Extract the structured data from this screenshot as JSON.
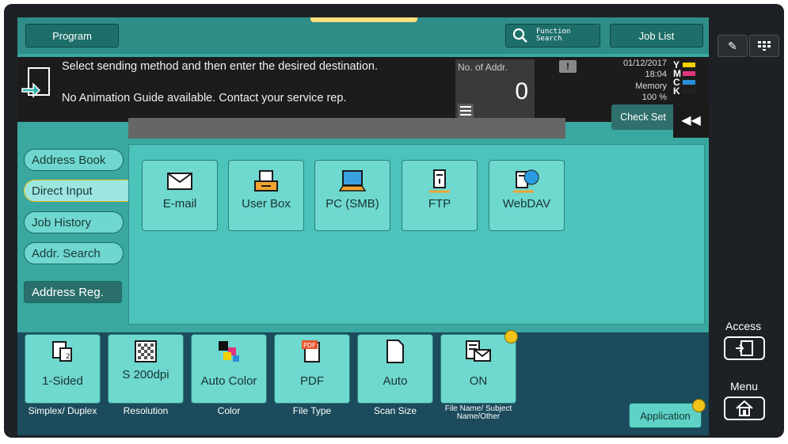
{
  "header": {
    "program_label": "Program",
    "function_search_label": "Function Search",
    "job_list_label": "Job List"
  },
  "message": {
    "line1": "Select sending method and then enter the desired destination.",
    "line2": "No Animation Guide available. Contact your service rep."
  },
  "addr_count": {
    "label": "No. of Addr.",
    "value": "0"
  },
  "status": {
    "date": "01/12/2017",
    "time": "18:04",
    "memory_label": "Memory",
    "memory_value": "100 %",
    "toners": [
      {
        "letter": "Y",
        "color": "#f2d100"
      },
      {
        "letter": "M",
        "color": "#e0357a"
      },
      {
        "letter": "C",
        "color": "#2a8fd6"
      },
      {
        "letter": "K",
        "color": "#222222"
      }
    ]
  },
  "check_setting_label": "Check Set",
  "left_menu": {
    "address_book": "Address Book",
    "direct_input": "Direct Input",
    "job_history": "Job History",
    "addr_search": "Addr. Search",
    "address_reg": "Address Reg."
  },
  "destinations": {
    "email": "E-mail",
    "user_box": "User Box",
    "pc_smb": "PC (SMB)",
    "ftp": "FTP",
    "webdav": "WebDAV"
  },
  "settings": {
    "simplex": {
      "value": "1-Sided",
      "label": "Simplex/ Duplex"
    },
    "resolution": {
      "value": "S 200dpi",
      "label": "Resolution"
    },
    "color": {
      "value": "Auto Color",
      "label": "Color"
    },
    "file_type": {
      "value": "PDF",
      "label": "File Type"
    },
    "scan_size": {
      "value": "Auto",
      "label": "Scan Size"
    },
    "file_name": {
      "value": "ON",
      "label": "File Name/ Subject Name/Other"
    }
  },
  "application_label": "Application",
  "side_panel": {
    "access_label": "Access",
    "menu_label": "Menu"
  },
  "colors": {
    "screen_bg": "#3aa7a0",
    "button_face": "#6fd8cf",
    "bottom_bar": "#1b4b5c",
    "accent_yellow": "#f0c419"
  }
}
